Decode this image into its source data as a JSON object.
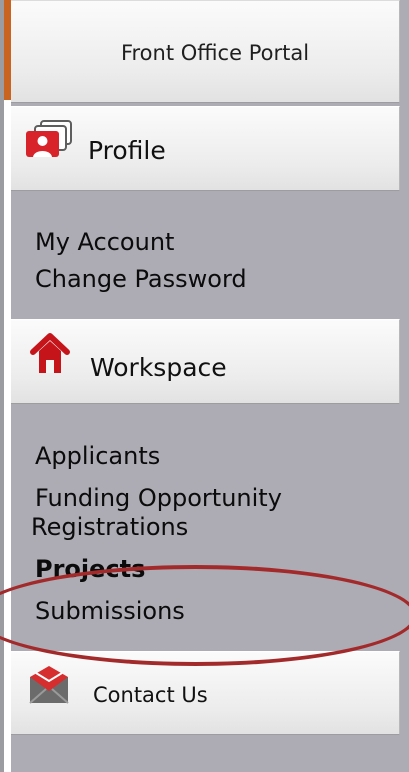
{
  "portal": {
    "title": "Front Office Portal"
  },
  "profile": {
    "label": "Profile",
    "icon": "profile-cards-icon",
    "items": [
      {
        "label": "My Account"
      },
      {
        "label": "Change Password"
      }
    ]
  },
  "workspace": {
    "label": "Workspace",
    "icon": "home-icon",
    "items": [
      {
        "label": "Applicants"
      },
      {
        "label": "Funding Opportunity"
      },
      {
        "label": "Registrations"
      },
      {
        "label": "Projects"
      },
      {
        "label": "Submissions"
      }
    ]
  },
  "contact": {
    "label": "Contact Us",
    "icon": "envelope-icon"
  },
  "colors": {
    "accent": "#c8641f",
    "highlight_ring": "#a32a2a",
    "nav_background": "#adacb4"
  }
}
